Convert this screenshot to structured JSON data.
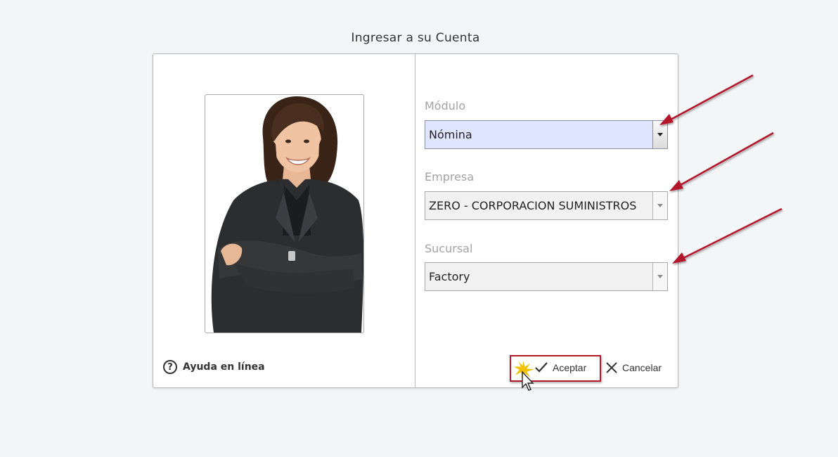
{
  "dialog": {
    "title": "Ingresar a su Cuenta"
  },
  "help": {
    "label": "Ayuda en línea",
    "icon": "question-circle-icon"
  },
  "form": {
    "modulo": {
      "label": "Módulo",
      "value": "Nómina"
    },
    "empresa": {
      "label": "Empresa",
      "value": "ZERO - CORPORACION SUMINISTROS"
    },
    "sucursal": {
      "label": "Sucursal",
      "value": "Factory"
    }
  },
  "buttons": {
    "accept_label": "Aceptar",
    "cancel_label": "Cancelar"
  },
  "colors": {
    "annotation": "#b3182a",
    "active_select": "#e0e6ff"
  }
}
